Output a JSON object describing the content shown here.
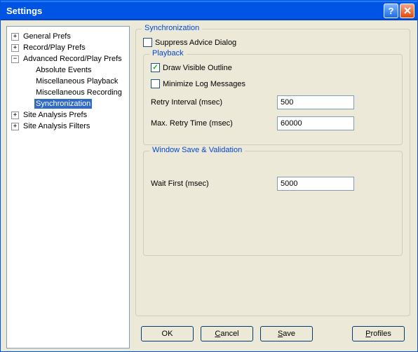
{
  "window": {
    "title": "Settings"
  },
  "tree": {
    "items": [
      {
        "label": "General Prefs",
        "expander": "+",
        "depth": 1,
        "selected": false
      },
      {
        "label": "Record/Play Prefs",
        "expander": "+",
        "depth": 1,
        "selected": false
      },
      {
        "label": "Advanced Record/Play Prefs",
        "expander": "−",
        "depth": 1,
        "selected": false
      },
      {
        "label": "Absolute Events",
        "expander": "",
        "depth": 2,
        "selected": false
      },
      {
        "label": "Miscellaneous Playback",
        "expander": "",
        "depth": 2,
        "selected": false
      },
      {
        "label": "Miscellaneous Recording",
        "expander": "",
        "depth": 2,
        "selected": false
      },
      {
        "label": "Synchronization",
        "expander": "",
        "depth": 2,
        "selected": true
      },
      {
        "label": "Site Analysis Prefs",
        "expander": "+",
        "depth": 1,
        "selected": false
      },
      {
        "label": "Site Analysis Filters",
        "expander": "+",
        "depth": 1,
        "selected": false
      }
    ]
  },
  "panel": {
    "main_legend": "Synchronization",
    "suppress_label": "Suppress Advice Dialog",
    "suppress_checked": false,
    "playback": {
      "legend": "Playback",
      "draw_label": "Draw Visible Outline",
      "draw_checked": true,
      "minimize_label": "Minimize Log Messages",
      "minimize_checked": false,
      "retry_interval_label": "Retry Interval (msec)",
      "retry_interval_value": "500",
      "max_retry_label": "Max. Retry Time (msec)",
      "max_retry_value": "60000"
    },
    "window_sv": {
      "legend": "Window Save & Validation",
      "wait_first_label": "Wait First (msec)",
      "wait_first_value": "5000"
    }
  },
  "buttons": {
    "ok": "OK",
    "cancel": "Cancel",
    "save": "Save",
    "profiles": "Profiles"
  }
}
